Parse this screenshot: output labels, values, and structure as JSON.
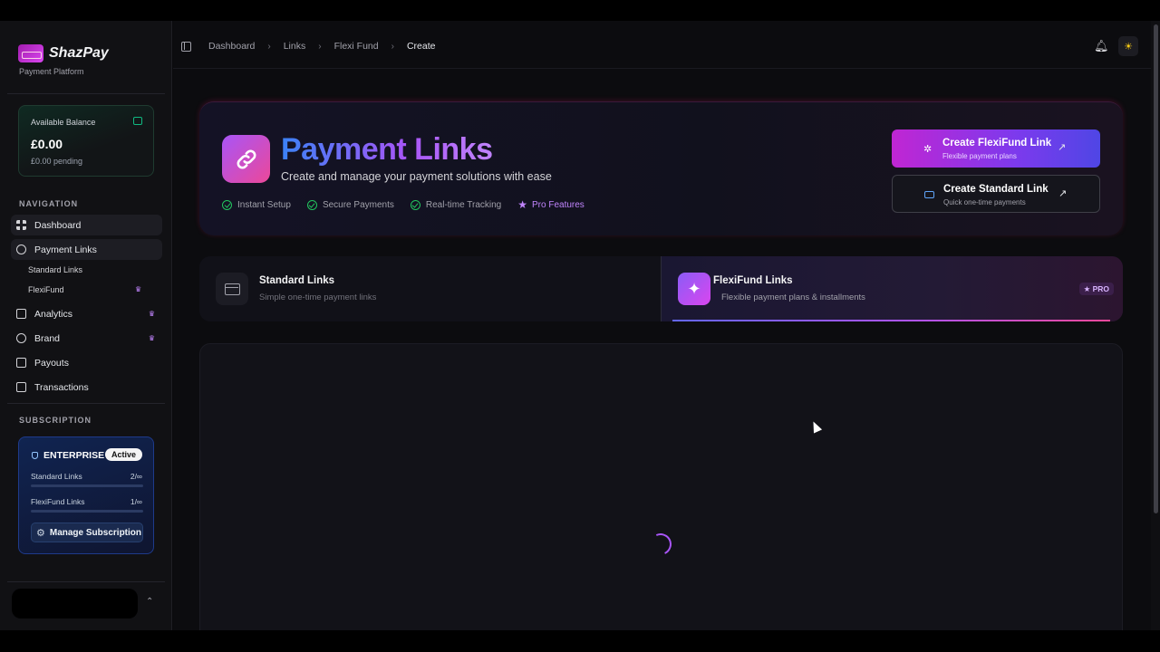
{
  "app": {
    "brand_name": "ShazPay",
    "brand_sub": "Payment Platform"
  },
  "balance": {
    "label": "Available Balance",
    "amount": "£0.00",
    "pending": "£0.00 pending"
  },
  "sidebar": {
    "nav_title": "NAVIGATION",
    "items": [
      {
        "label": "Dashboard",
        "icon": "grid-icon"
      },
      {
        "label": "Payment Links",
        "icon": "link-icon"
      },
      {
        "label": "Standard Links"
      },
      {
        "label": "FlexiFund",
        "crown": true
      },
      {
        "label": "Analytics",
        "icon": "chart-icon",
        "crown": true
      },
      {
        "label": "Brand",
        "icon": "palette-icon",
        "crown": true
      },
      {
        "label": "Payouts",
        "icon": "card-icon"
      },
      {
        "label": "Transactions",
        "icon": "banknote-icon"
      }
    ],
    "subscription_title": "SUBSCRIPTION"
  },
  "subscription": {
    "tier": "ENTERPRISE",
    "status": "Active",
    "standard_label": "Standard Links",
    "standard_value": "2/∞",
    "flexi_label": "FlexiFund Links",
    "flexi_value": "1/∞",
    "manage_label": "Manage Subscription"
  },
  "breadcrumb": [
    "Dashboard",
    "Links",
    "Flexi Fund",
    "Create"
  ],
  "hero": {
    "title": "Payment Links",
    "subtitle": "Create and manage your payment solutions with ease",
    "features": [
      "Instant Setup",
      "Secure Payments",
      "Real-time Tracking"
    ],
    "pro_feature": "Pro Features"
  },
  "actions": {
    "flexi_title": "Create FlexiFund Link",
    "flexi_sub": "Flexible payment plans",
    "standard_title": "Create Standard Link",
    "standard_sub": "Quick one-time payments"
  },
  "tabs": {
    "standard_title": "Standard Links",
    "standard_sub": "Simple one-time payment links",
    "flexi_title": "FlexiFund Links",
    "flexi_sub": "Flexible payment plans & installments",
    "pro_badge": "PRO"
  },
  "colors": {
    "accent_purple": "#a855f7",
    "accent_pink": "#ec4899",
    "accent_blue": "#3b82f6",
    "success": "#22c55e"
  }
}
